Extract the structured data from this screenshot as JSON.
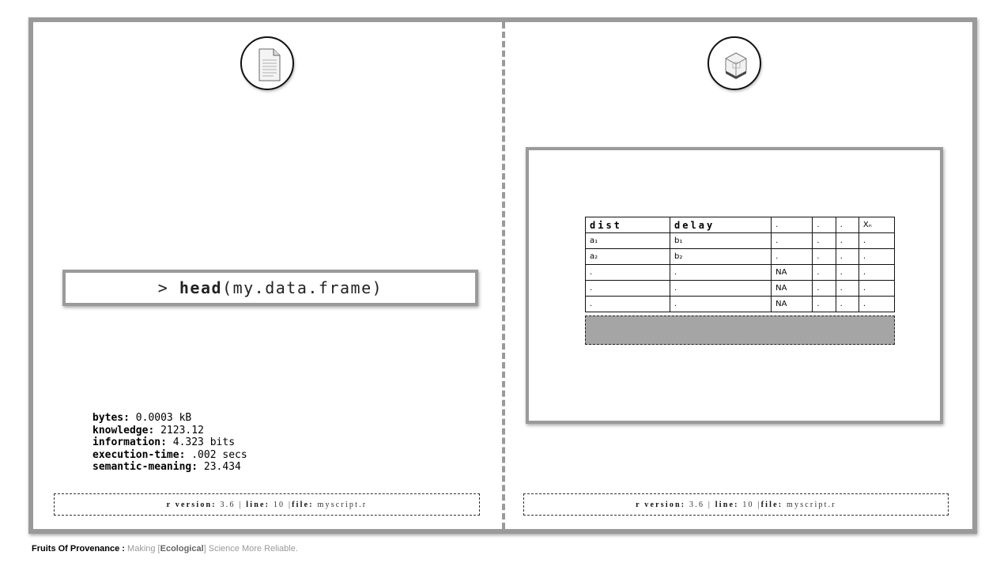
{
  "left_panel": {
    "icon": "document-icon",
    "command_prompt": ">",
    "command_function": "head",
    "command_args": "(my.data.frame)",
    "stats": [
      {
        "key": "bytes:",
        "value": " 0.0003 kB"
      },
      {
        "key": "knowledge:",
        "value": " 2123.12"
      },
      {
        "key": "information:",
        "value": " 4.323 bits"
      },
      {
        "key": "execution-time:",
        "value": " .002 secs"
      },
      {
        "key": "semantic-meaning:",
        "value": " 23.434"
      }
    ],
    "footer": {
      "r_version_label": "r version:",
      "r_version_value": " 3.6 | ",
      "line_label": "line:",
      "line_value": " 10 |",
      "file_label": "file:",
      "file_value": " myscript.r"
    }
  },
  "right_panel": {
    "icon": "cube-icon",
    "table": {
      "headers": [
        "dist",
        "delay",
        ".",
        ".",
        ".",
        "Xₙ"
      ],
      "rows": [
        [
          "a₁",
          "b₁",
          ".",
          ".",
          ".",
          "."
        ],
        [
          "a₂",
          "b₂",
          ".",
          ".",
          ".",
          "."
        ],
        [
          ".",
          ".",
          "NA",
          ".",
          ".",
          "."
        ],
        [
          ".",
          ".",
          "NA",
          ".",
          ".",
          "."
        ],
        [
          ".",
          ".",
          "NA",
          ".",
          ".",
          "."
        ]
      ]
    },
    "footer": {
      "r_version_label": "r version:",
      "r_version_value": " 3.6 | ",
      "line_label": "line:",
      "line_value": " 10 |",
      "file_label": "file:",
      "file_value": " myscript.r"
    }
  },
  "caption": {
    "title": "Fruits Of Provenance :",
    "text_before": " Making [",
    "highlight": "Ecological",
    "text_after": "] Science More Reliable."
  }
}
